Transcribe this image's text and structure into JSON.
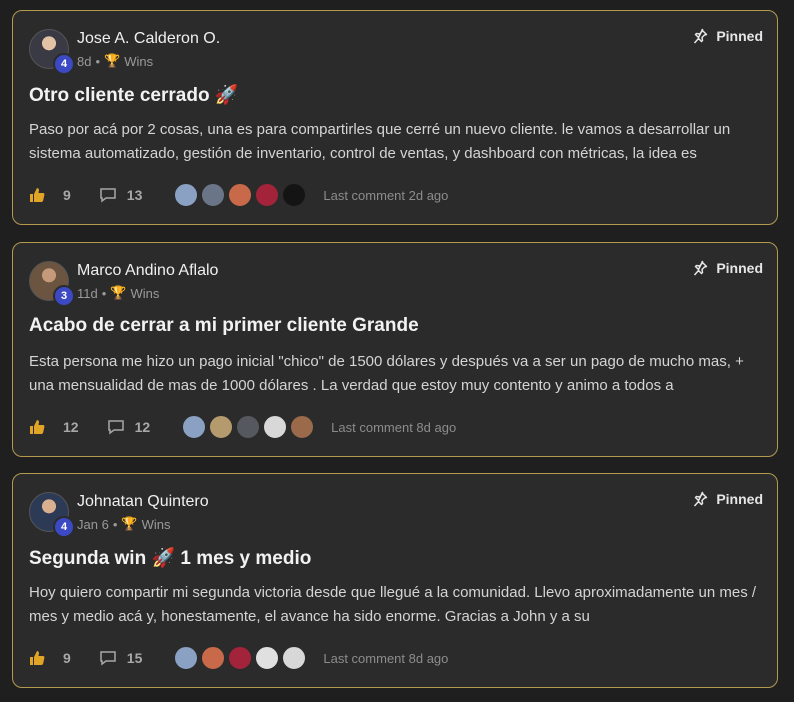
{
  "posts": [
    {
      "author": "Jose A. Calderon O.",
      "level": "4",
      "age": "8d",
      "category": "Wins",
      "pinned_label": "Pinned",
      "title": "Otro cliente cerrado 🚀",
      "body": "Paso por acá por 2 cosas, una es para compartirles que cerré un nuevo cliente. le vamos a desarrollar un sistema automatizado, gestión de inventario, control de ventas, y dashboard con métricas, la idea es",
      "likes": "9",
      "comments": "13",
      "last_comment": "Last comment 2d ago",
      "commenter_colors": [
        "#8aa1c4",
        "#6a7688",
        "#c86a4a",
        "#a3243a",
        "#141414"
      ]
    },
    {
      "author": "Marco Andino Aflalo",
      "level": "3",
      "age": "11d",
      "category": "Wins",
      "pinned_label": "Pinned",
      "title": "Acabo de cerrar a mi primer cliente Grande",
      "body": "Esta persona me hizo un pago inicial \"chico\" de 1500 dólares y después va a ser un pago de mucho mas, + una mensualidad de mas de 1000 dólares . La verdad que estoy muy contento y animo a todos a",
      "likes": "12",
      "comments": "12",
      "last_comment": "Last comment 8d ago",
      "commenter_colors": [
        "#8aa1c4",
        "#b59a6e",
        "#55585e",
        "#d8d8d8",
        "#9a6a4a"
      ]
    },
    {
      "author": "Johnatan Quintero",
      "level": "4",
      "age": "Jan 6",
      "category": "Wins",
      "pinned_label": "Pinned",
      "title": "Segunda win 🚀 1 mes y medio",
      "body": "Hoy quiero compartir mi segunda victoria desde que llegué a la comunidad. Llevo aproximadamente un mes / mes y medio acá y, honestamente, el avance ha sido enorme. Gracias a John y a su",
      "likes": "9",
      "comments": "15",
      "last_comment": "Last comment 8d ago",
      "commenter_colors": [
        "#8aa1c4",
        "#c86a4a",
        "#a3243a",
        "#e0e0e0",
        "#d8d8d8"
      ]
    }
  ]
}
